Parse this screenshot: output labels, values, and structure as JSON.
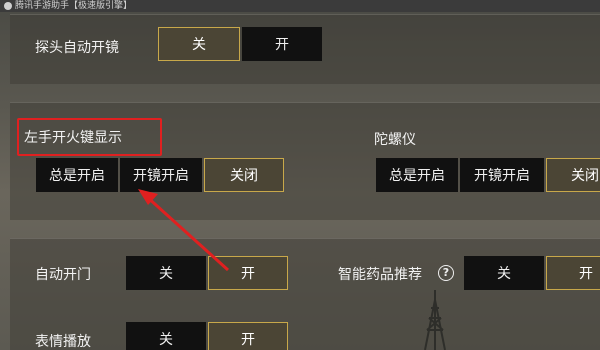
{
  "window": {
    "title": "腾讯手游助手【极速版引擎】"
  },
  "settings": {
    "peek_scope": {
      "label": "探头自动开镜",
      "options": [
        "关",
        "开"
      ],
      "selected": "关"
    },
    "left_fire": {
      "label": "左手开火键显示",
      "options": [
        "总是开启",
        "开镜开启",
        "关闭"
      ],
      "selected": "关闭"
    },
    "gyroscope": {
      "label": "陀螺仪",
      "options": [
        "总是开启",
        "开镜开启",
        "关闭"
      ],
      "selected": "关闭"
    },
    "auto_door": {
      "label": "自动开门",
      "options": [
        "关",
        "开"
      ],
      "selected": "开"
    },
    "smart_medicine": {
      "label": "智能药品推荐",
      "help": "?",
      "options": [
        "关",
        "开"
      ],
      "selected": "开"
    },
    "emote_play": {
      "label": "表情播放",
      "options": [
        "关",
        "开"
      ],
      "selected": "开"
    }
  },
  "colors": {
    "highlight_red": "#e02020",
    "selected_border": "#c8a84a"
  },
  "icons": [
    "help-icon",
    "app-logo-icon",
    "annotation-arrow-icon"
  ]
}
